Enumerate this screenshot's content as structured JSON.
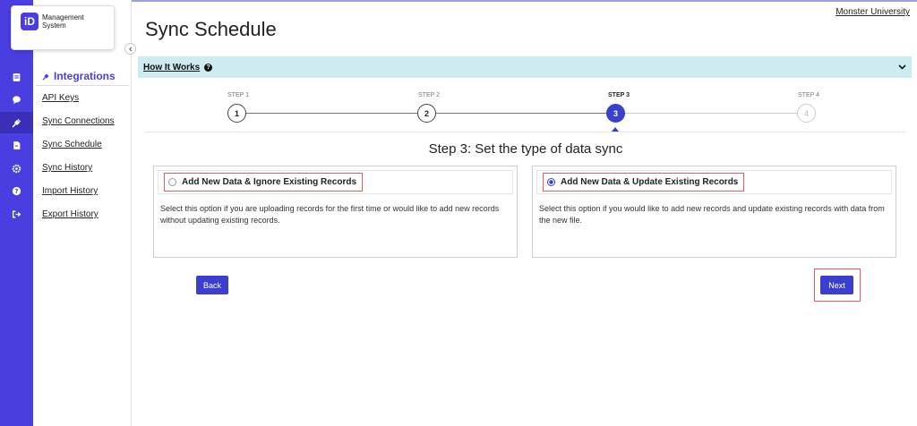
{
  "logo": {
    "mark": "iD",
    "line1": "Management",
    "line2": "System"
  },
  "rail_icons": [
    "id-card-icon",
    "chat-icon",
    "plug-icon",
    "document-icon",
    "gear-icon",
    "help-icon",
    "logout-icon"
  ],
  "submenu": {
    "title": "Integrations",
    "items": [
      "API Keys",
      "Sync Connections",
      "Sync Schedule",
      "Sync History",
      "Import History",
      "Export History"
    ]
  },
  "header": {
    "university": "Monster University",
    "page_title": "Sync Schedule"
  },
  "how_it_works": {
    "label": "How It Works",
    "help": "?"
  },
  "steps": [
    {
      "label": "STEP 1",
      "number": "1",
      "state": "done"
    },
    {
      "label": "STEP 2",
      "number": "2",
      "state": "done"
    },
    {
      "label": "STEP 3",
      "number": "3",
      "state": "current"
    },
    {
      "label": "STEP 4",
      "number": "4",
      "state": "pending"
    }
  ],
  "step_heading": "Step 3: Set the type of data sync",
  "options": [
    {
      "title": "Add New Data & Ignore Existing Records",
      "description": "Select this option if you are uploading records for the first time or would like to add new records without updating existing records.",
      "selected": false
    },
    {
      "title": "Add New Data & Update Existing Records",
      "description": "Select this option if you would like to add new records and update existing records with data from the new file.",
      "selected": true
    }
  ],
  "buttons": {
    "back": "Back",
    "next": "Next"
  },
  "colors": {
    "rail": "#4a3ee0",
    "accent": "#3a3fd0",
    "info_bar": "#cdebf1",
    "highlight": "#e06060"
  }
}
